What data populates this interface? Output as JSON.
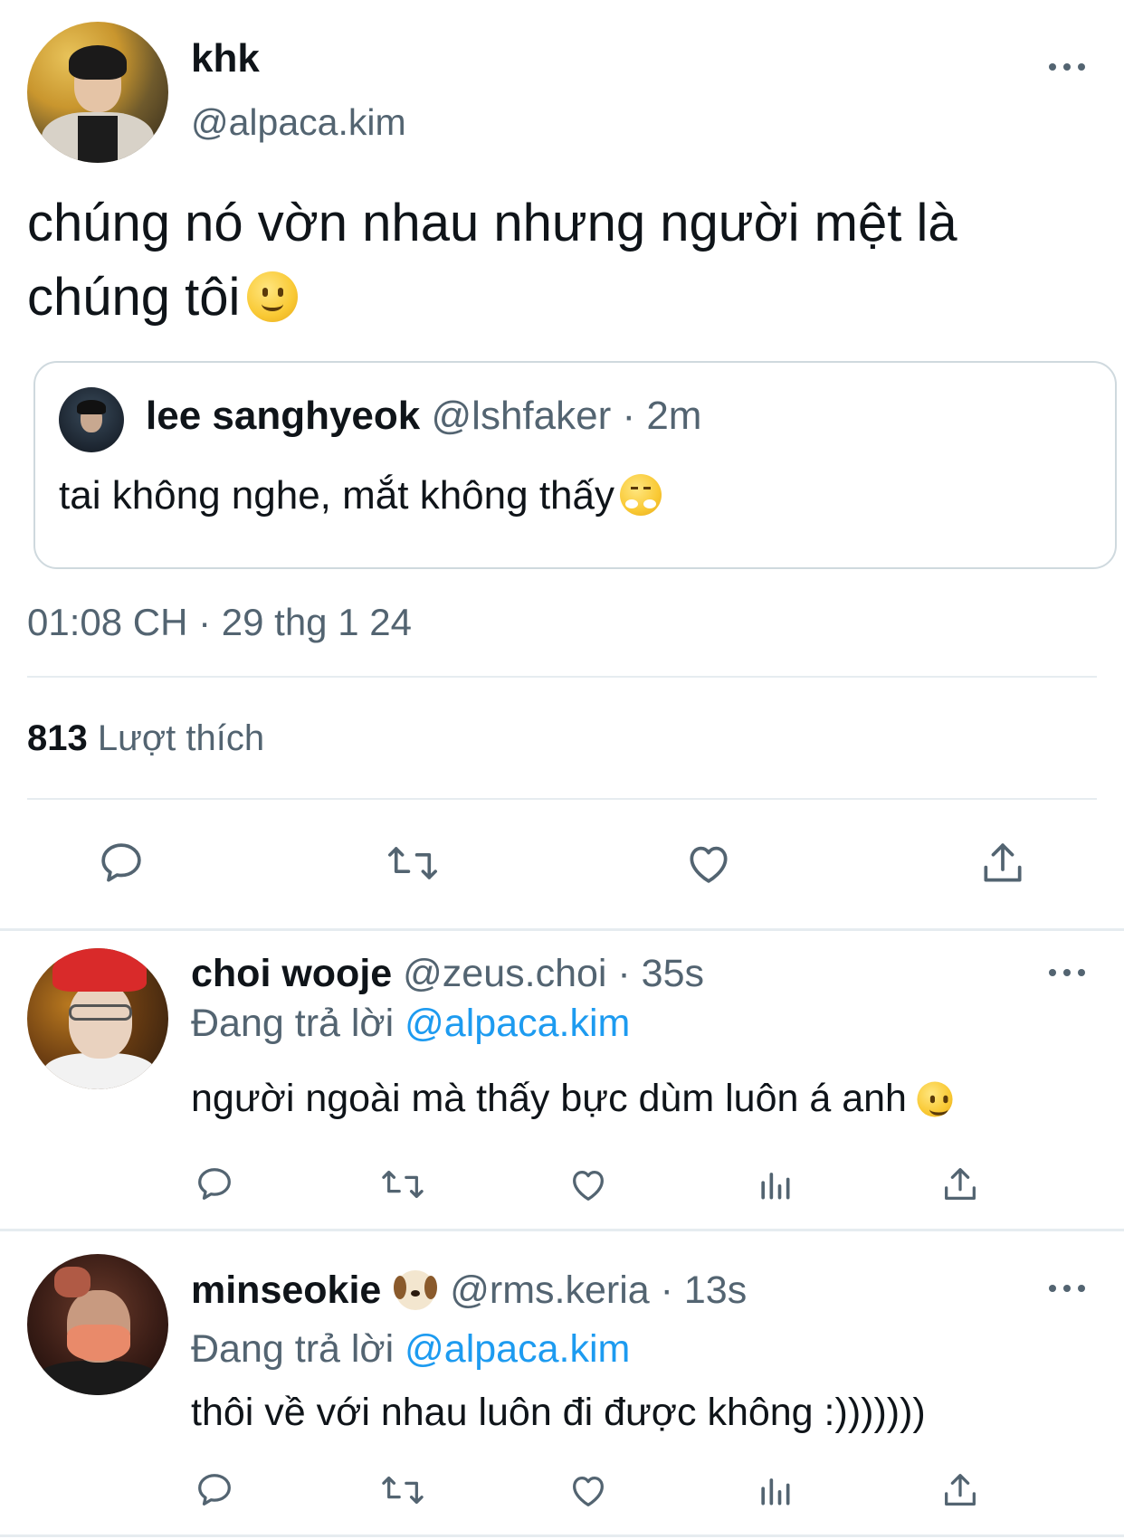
{
  "main_tweet": {
    "display_name": "khk",
    "handle": "@alpaca.kim",
    "text_line1": "chúng nó vờn nhau nhưng người mệt là",
    "text_line2": "chúng tôi",
    "timestamp": "01:08 CH · 29 thg 1 24",
    "likes_count": "813",
    "likes_label": "Lượt thích",
    "quote": {
      "display_name": "lee sanghyeok",
      "meta": "@lshfaker · 2m",
      "text": "tai không nghe, mắt không thấy"
    },
    "actions": [
      "reply-icon",
      "retweet-icon",
      "like-icon",
      "share-icon"
    ]
  },
  "replies": [
    {
      "display_name": "choi wooje",
      "meta": "@zeus.choi · 35s",
      "replying_prefix": "Đang trả lời",
      "replying_to": "@alpaca.kim",
      "text": "người ngoài mà thấy bực dùm luôn á anh"
    },
    {
      "display_name": "minseokie",
      "meta": "@rms.keria · 13s",
      "replying_prefix": "Đang trả lời",
      "replying_to": "@alpaca.kim",
      "text": "thôi về với nhau luôn đi được không :)))))))"
    }
  ],
  "colors": {
    "text_primary": "#0f1419",
    "text_secondary": "#536471",
    "accent": "#1d9bf0",
    "divider": "#e6ecf0"
  }
}
